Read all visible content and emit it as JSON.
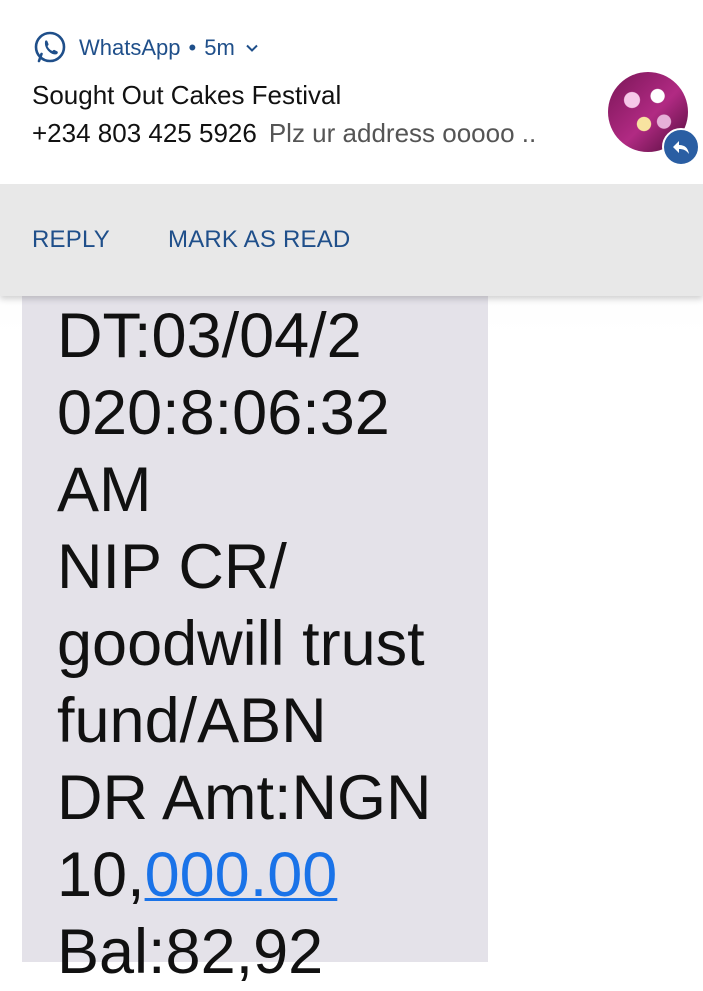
{
  "notification": {
    "app_name": "WhatsApp",
    "separator": "•",
    "time_ago": "5m",
    "title": "Sought Out Cakes Festival",
    "sender": "+234 803 425 5926",
    "preview": "Plz ur address ooooo ..",
    "actions": {
      "reply": "REPLY",
      "mark_as_read": "MARK AS READ"
    }
  },
  "sms": {
    "lines": [
      "DT:03/04/2",
      "020:8:06:32",
      "AM",
      "NIP CR/",
      "goodwill trust",
      "fund/ABN",
      "DR Amt:NGN"
    ],
    "amount_prefix": "10,",
    "amount_link": "000.00",
    "partial_line": "Bal:82,92"
  },
  "colors": {
    "accent": "#1f4f8a",
    "link": "#1a73e8",
    "bubble": "#e4e2e9"
  }
}
